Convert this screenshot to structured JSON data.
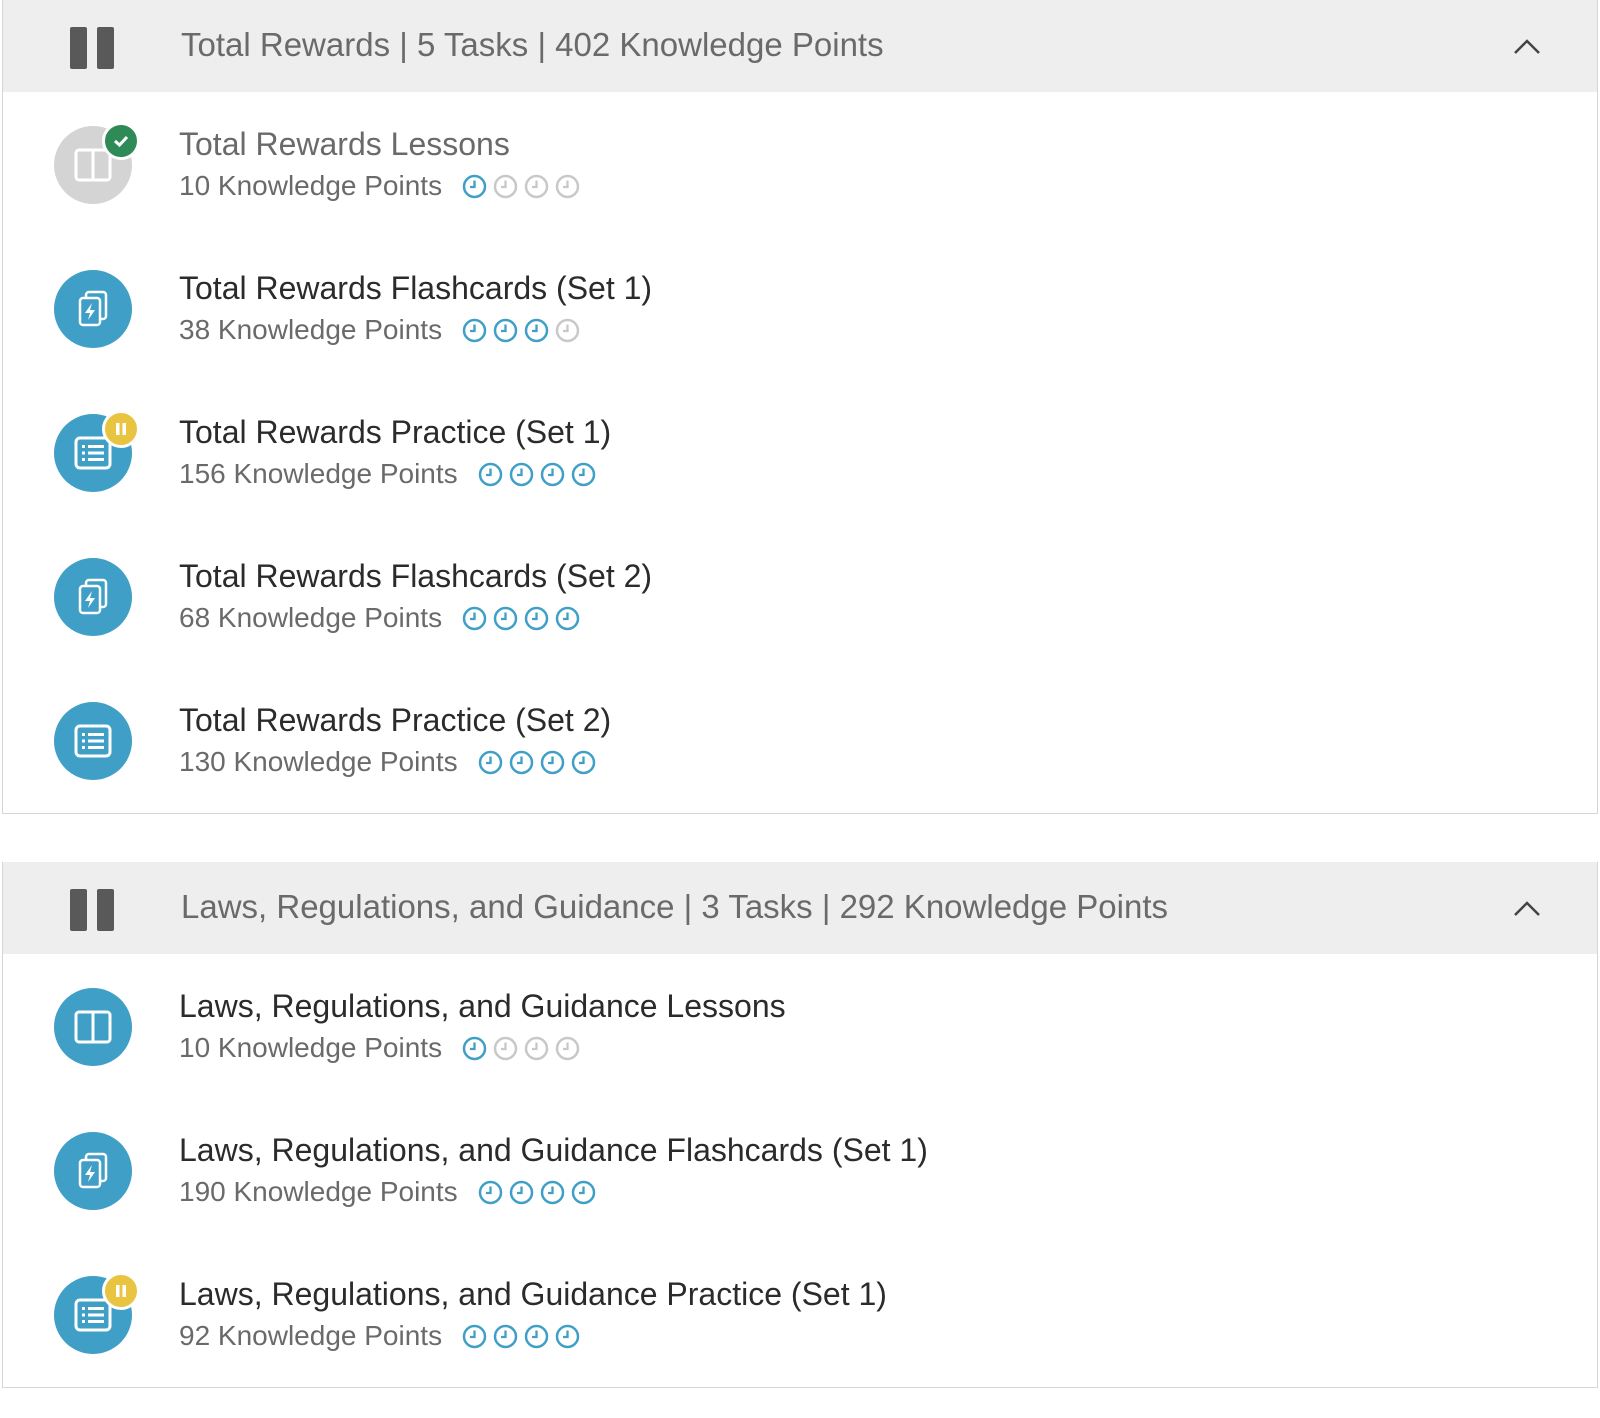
{
  "sections": [
    {
      "title": "Total Rewards | 5 Tasks | 402 Knowledge Points",
      "tasks": [
        {
          "title": "Total Rewards Lessons",
          "points": "10 Knowledge Points",
          "icon": "book-icon",
          "status": "completed",
          "clocks_filled": 1
        },
        {
          "title": "Total Rewards Flashcards (Set 1)",
          "points": "38 Knowledge Points",
          "icon": "flashcards-icon",
          "status": "none",
          "clocks_filled": 3
        },
        {
          "title": "Total Rewards Practice (Set 1)",
          "points": "156 Knowledge Points",
          "icon": "practice-list-icon",
          "status": "paused",
          "clocks_filled": 4
        },
        {
          "title": "Total Rewards Flashcards (Set 2)",
          "points": "68 Knowledge Points",
          "icon": "flashcards-icon",
          "status": "none",
          "clocks_filled": 4
        },
        {
          "title": "Total Rewards Practice (Set 2)",
          "points": "130 Knowledge Points",
          "icon": "practice-list-icon",
          "status": "none",
          "clocks_filled": 4
        }
      ]
    },
    {
      "title": "Laws, Regulations, and Guidance | 3 Tasks | 292 Knowledge Points",
      "tasks": [
        {
          "title": "Laws, Regulations, and Guidance Lessons",
          "points": "10 Knowledge Points",
          "icon": "book-icon",
          "status": "none",
          "clocks_filled": 1
        },
        {
          "title": "Laws, Regulations, and Guidance Flashcards (Set 1)",
          "points": "190 Knowledge Points",
          "icon": "flashcards-icon",
          "status": "none",
          "clocks_filled": 4
        },
        {
          "title": "Laws, Regulations, and Guidance Practice (Set 1)",
          "points": "92 Knowledge Points",
          "icon": "practice-list-icon",
          "status": "paused",
          "clocks_filled": 4
        }
      ]
    }
  ],
  "colors": {
    "accent": "#3f9fc6",
    "clock_empty": "#c8c8c8",
    "completed": "#2e8b57",
    "paused": "#e8c440",
    "header_bg": "#eeeeee"
  }
}
